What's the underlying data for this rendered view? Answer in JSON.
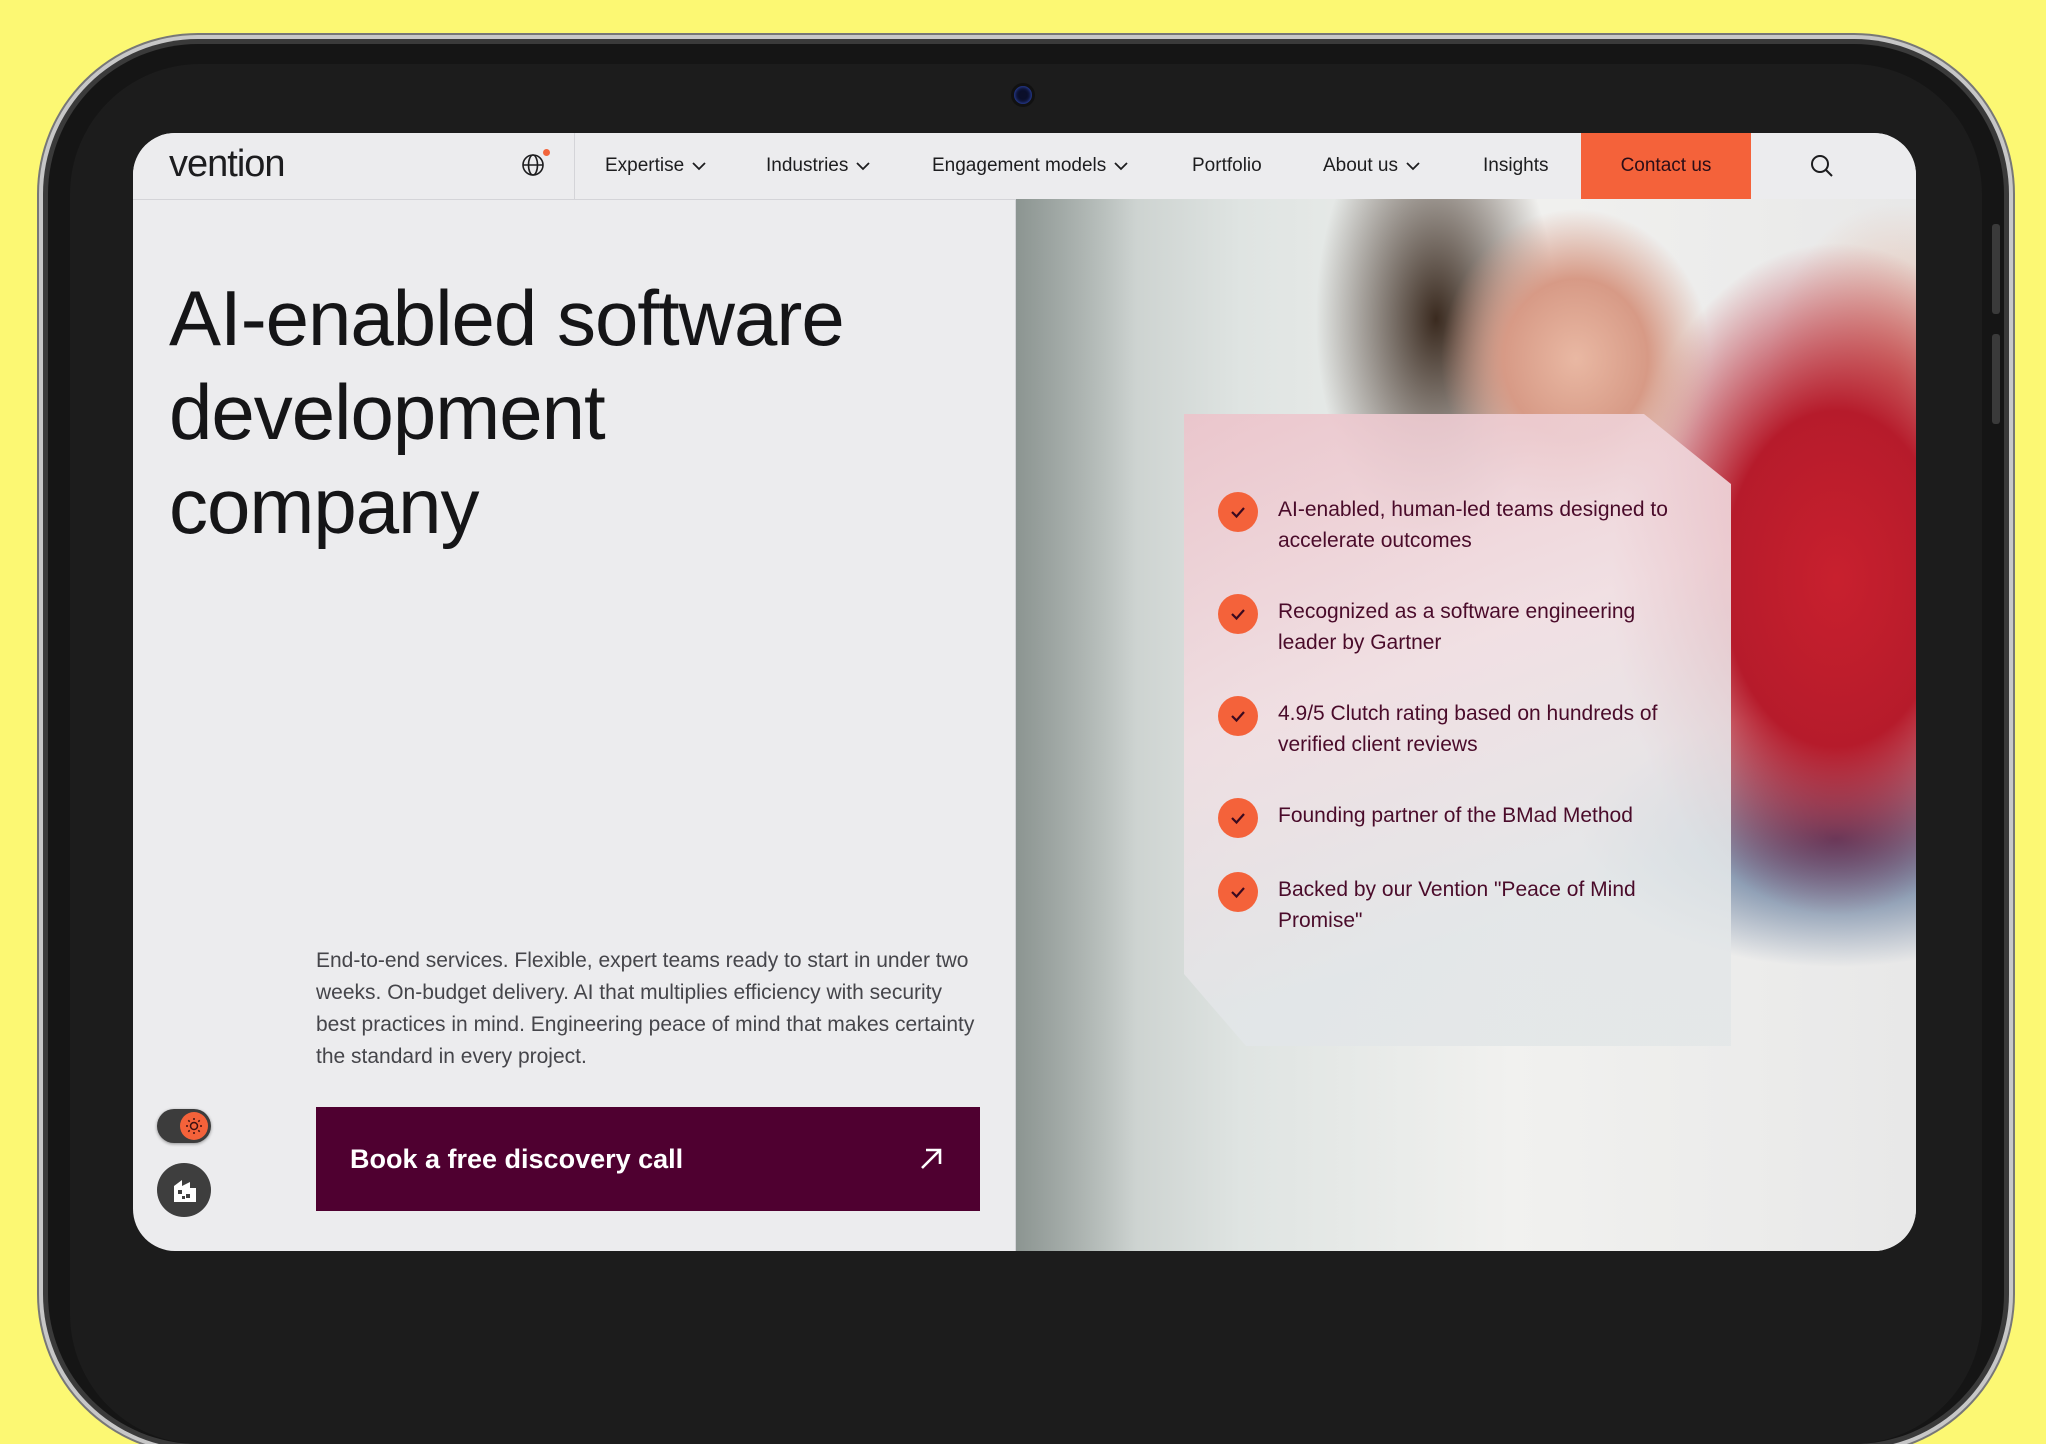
{
  "brand": {
    "logo_text": "vention",
    "accent": "#f4623a",
    "cta_color": "#4f0030"
  },
  "nav": {
    "items": [
      {
        "label": "Expertise",
        "dropdown": true
      },
      {
        "label": "Industries",
        "dropdown": true
      },
      {
        "label": "Engagement models",
        "dropdown": true
      },
      {
        "label": "Portfolio",
        "dropdown": false
      },
      {
        "label": "About us",
        "dropdown": true
      },
      {
        "label": "Insights",
        "dropdown": false
      }
    ],
    "contact_label": "Contact us",
    "icons": [
      "globe-icon",
      "search-icon"
    ]
  },
  "hero": {
    "title_lines": [
      "AI-enabled software",
      "development",
      "company"
    ],
    "lead": "End-to-end services. Flexible, expert teams ready to start in under two weeks. On-budget delivery. AI that multiplies efficiency with security best practices in mind. Engineering peace of mind that makes certainty the standard in every project.",
    "cta_label": "Book a free discovery call"
  },
  "highlights": [
    "AI-enabled, human-led teams designed to accelerate outcomes",
    "Recognized as a software engineering leader by Gartner",
    "4.9/5 Clutch rating based on hundreds of verified client reviews",
    "Founding partner of the BMad Method",
    "Backed by our Vention \"Peace of Mind Promise\""
  ],
  "widgets": {
    "theme_toggle_icon": "sun-icon",
    "accessibility_icon": "accessibility-icon"
  }
}
